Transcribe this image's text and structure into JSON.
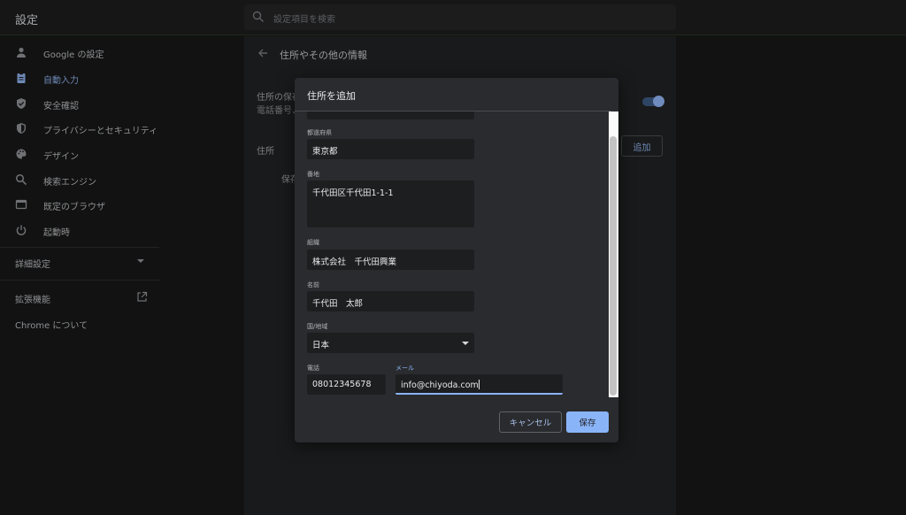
{
  "app": {
    "title": "設定"
  },
  "search": {
    "placeholder": "設定項目を検索"
  },
  "sidebar": {
    "items": [
      {
        "label": "Google の設定",
        "icon": "person-icon"
      },
      {
        "label": "自動入力",
        "icon": "clipboard-icon",
        "active": true
      },
      {
        "label": "安全確認",
        "icon": "shield-check-icon"
      },
      {
        "label": "プライバシーとセキュリティ",
        "icon": "shield-icon"
      },
      {
        "label": "デザイン",
        "icon": "palette-icon"
      },
      {
        "label": "検索エンジン",
        "icon": "search-icon"
      },
      {
        "label": "既定のブラウザ",
        "icon": "browser-icon"
      },
      {
        "label": "起動時",
        "icon": "power-icon"
      }
    ],
    "advanced": "詳細設定",
    "extensions": "拡張機能",
    "about": "Chrome について"
  },
  "main": {
    "title": "住所やその他の情報",
    "description_line1": "住所の保存",
    "description_line2": "電話番号、",
    "addresses_label": "住所",
    "saved_label": "保存",
    "add_button": "追加"
  },
  "dialog": {
    "title": "住所を追加",
    "fields": {
      "prefecture": {
        "label": "都道府県",
        "value": "東京都"
      },
      "street": {
        "label": "番地",
        "value": "千代田区千代田1-1-1"
      },
      "organization": {
        "label": "組織",
        "value": "株式会社　千代田興業"
      },
      "name": {
        "label": "名前",
        "value": "千代田　太郎"
      },
      "country": {
        "label": "国/地域",
        "value": "日本"
      },
      "phone": {
        "label": "電話",
        "value": "08012345678"
      },
      "email": {
        "label": "メール",
        "value": "info@chiyoda.com"
      }
    },
    "cancel_button": "キャンセル",
    "save_button": "保存"
  },
  "colors": {
    "accent": "#8ab4f8",
    "dialog_bg": "#2a2b2e",
    "field_bg": "#1d1e20",
    "page_bg": "#121212"
  }
}
